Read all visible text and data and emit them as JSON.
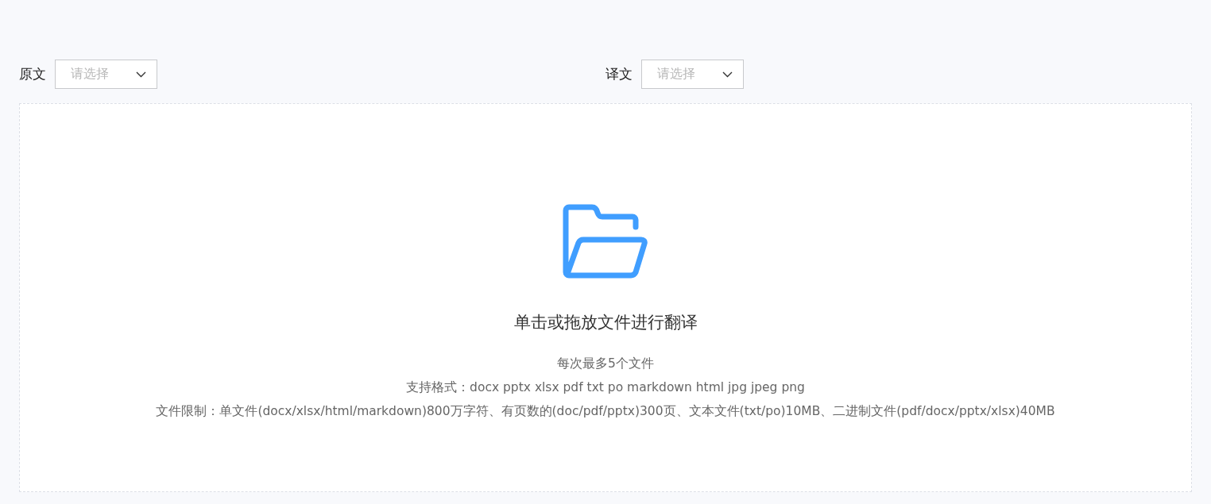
{
  "selectors": [
    {
      "label": "原文",
      "placeholder": "请选择"
    },
    {
      "label": "译文",
      "placeholder": "请选择"
    }
  ],
  "upload": {
    "title": "单击或拖放文件进行翻译",
    "notes": [
      "每次最多5个文件",
      "支持格式：docx pptx xlsx pdf txt po markdown html jpg jpeg png",
      "文件限制：单文件(docx/xlsx/html/markdown)800万字符、有页数的(doc/pdf/pptx)300页、文本文件(txt/po)10MB、二进制文件(pdf/docx/pptx/xlsx)40MB"
    ]
  }
}
